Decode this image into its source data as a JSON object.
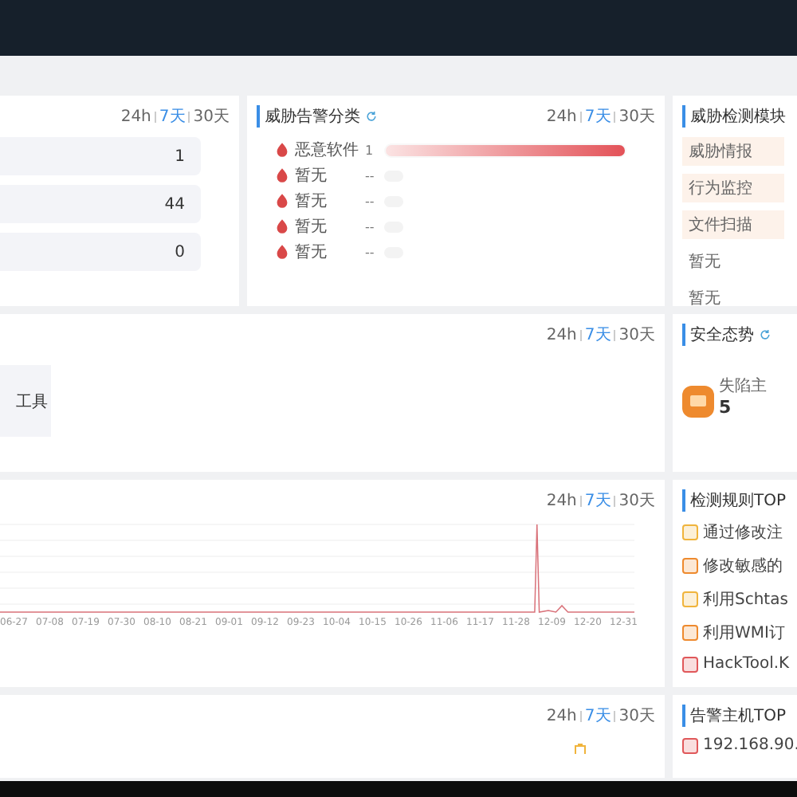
{
  "stats_panel": {
    "range": [
      {
        "label": "24h",
        "selected": false
      },
      {
        "label": "7天",
        "selected": true
      },
      {
        "label": "30天",
        "selected": false
      }
    ],
    "values": [
      "1",
      "44",
      "0"
    ]
  },
  "threat_classes": {
    "title": "威胁告警分类",
    "range": [
      {
        "label": "24h",
        "selected": false
      },
      {
        "label": "7天",
        "selected": true
      },
      {
        "label": "30天",
        "selected": false
      }
    ],
    "items": [
      {
        "name": "恶意软件",
        "count": "1",
        "level": 1
      },
      {
        "name": "暂无",
        "count": "--"
      },
      {
        "name": "暂无",
        "count": "--"
      },
      {
        "name": "暂无",
        "count": "--"
      },
      {
        "name": "暂无",
        "count": "--"
      }
    ]
  },
  "modules": {
    "title": "威胁检测模块",
    "items": [
      {
        "label": "威胁情报",
        "highlighted": true
      },
      {
        "label": "行为监控",
        "highlighted": true
      },
      {
        "label": "文件扫描",
        "highlighted": true
      },
      {
        "label": "暂无",
        "highlighted": false
      },
      {
        "label": "暂无",
        "highlighted": false
      }
    ]
  },
  "tools_panel": {
    "range": [
      {
        "label": "24h",
        "selected": false
      },
      {
        "label": "7天",
        "selected": true
      },
      {
        "label": "30天",
        "selected": false
      }
    ],
    "card_text": "工具"
  },
  "security": {
    "title": "安全态势",
    "label": "失陷主",
    "value": "5"
  },
  "trend": {
    "range": [
      {
        "label": "24h",
        "selected": false
      },
      {
        "label": "7天",
        "selected": true
      },
      {
        "label": "30天",
        "selected": false
      }
    ],
    "x_labels": [
      "06-27",
      "07-08",
      "07-19",
      "07-30",
      "08-10",
      "08-21",
      "09-01",
      "09-12",
      "09-23",
      "10-04",
      "10-15",
      "10-26",
      "11-06",
      "11-17",
      "11-28",
      "12-09",
      "12-20",
      "12-31"
    ]
  },
  "rules": {
    "title": "检测规则TOP",
    "items": [
      {
        "label": "通过修改注",
        "color": "#f0b43c"
      },
      {
        "label": "修改敏感的",
        "color": "#ee8a2e"
      },
      {
        "label": "利用Schtas",
        "color": "#f0b43c"
      },
      {
        "label": "利用WMI订",
        "color": "#ee8a2e"
      },
      {
        "label": "HackTool.K",
        "color": "#e0585a"
      }
    ]
  },
  "alerts_panel": {
    "range": [
      {
        "label": "24h",
        "selected": false
      },
      {
        "label": "7天",
        "selected": true
      },
      {
        "label": "30天",
        "selected": false
      }
    ]
  },
  "hosts": {
    "title": "告警主机TOP",
    "items": [
      {
        "label": "192.168.90.",
        "color": "#e0585a"
      }
    ]
  }
}
